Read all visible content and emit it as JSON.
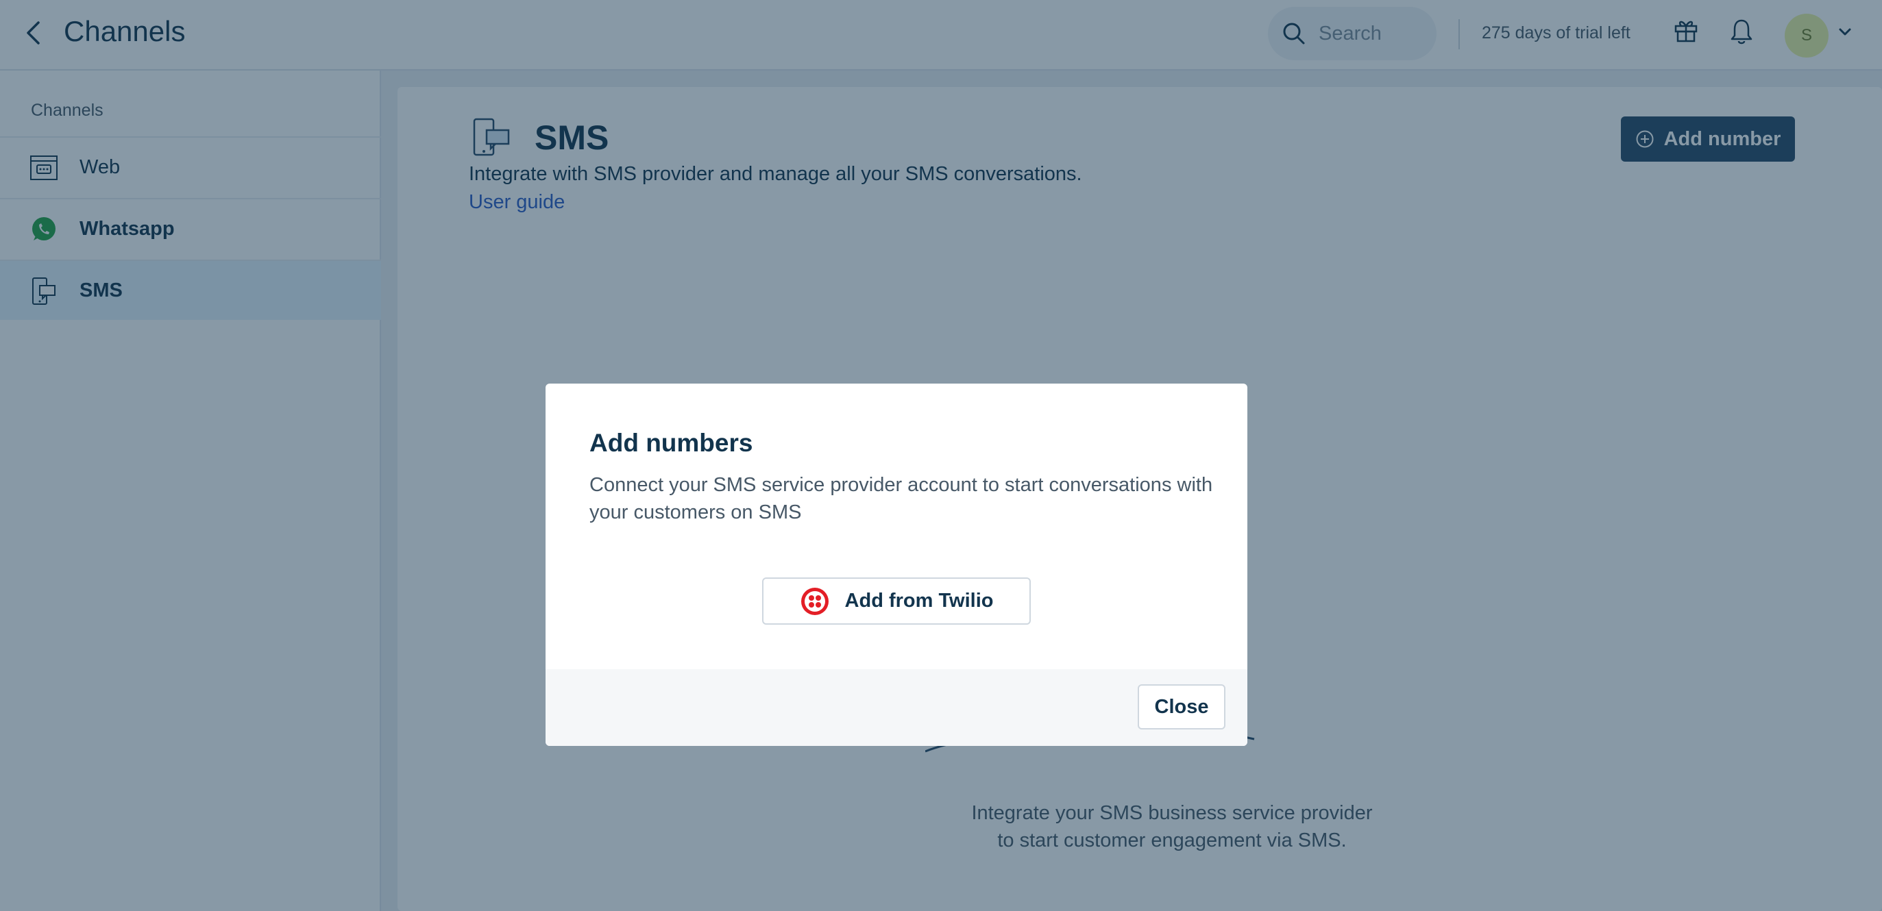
{
  "header": {
    "title": "Channels",
    "search_placeholder": "Search",
    "trial_text": "275 days of trial left",
    "avatar_initial": "S"
  },
  "sidebar": {
    "heading": "Channels",
    "items": [
      {
        "label": "Web",
        "icon": "web-chat-icon"
      },
      {
        "label": "Whatsapp",
        "icon": "whatsapp-icon"
      },
      {
        "label": "SMS",
        "icon": "sms-icon",
        "active": true
      }
    ]
  },
  "main": {
    "title": "SMS",
    "description": "Integrate with SMS provider and manage all your SMS conversations.",
    "user_guide_label": "User guide",
    "add_number_label": "Add number",
    "empty_line1": "Integrate your SMS business service provider",
    "empty_line2": "to start customer engagement via SMS."
  },
  "modal": {
    "title": "Add numbers",
    "description": "Connect your SMS service provider account to start conversations with your customers on SMS",
    "twilio_label": "Add from Twilio",
    "close_label": "Close"
  },
  "colors": {
    "primary_button": "#264966",
    "link": "#2c5cc5",
    "active_item": "#e5f2fd",
    "twilio_red": "#e31e26",
    "whatsapp_green": "#25a244"
  }
}
